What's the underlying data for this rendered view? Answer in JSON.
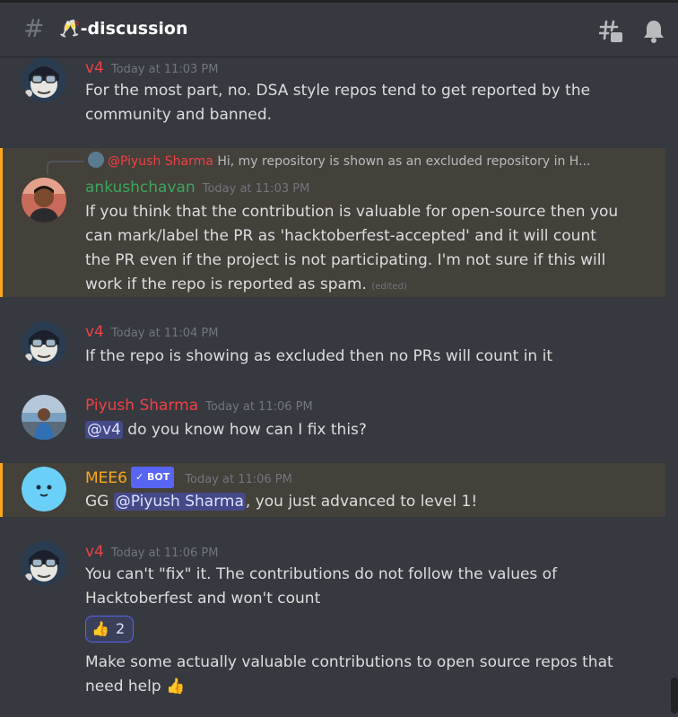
{
  "channel": {
    "icon": "hash-icon",
    "name": "🥂-discussion"
  },
  "header_icons": [
    "threads-icon",
    "bell-icon"
  ],
  "messages": [
    {
      "author": "v4",
      "author_color": "#ed4245",
      "time": "Today at 11:03 PM",
      "lines": [
        "For the most part, no. DSA style repos tend to get reported by the",
        "community and banned."
      ]
    },
    {
      "reply_to_name": "@Piyush Sharma",
      "reply_preview": "Hi, my repository is shown as an excluded repository in H...",
      "author": "ankushchavan",
      "author_color": "#3ba55d",
      "time": "Today at 11:03 PM",
      "lines": [
        "If you think that the contribution is valuable for open-source then you",
        "can mark/label the PR as 'hacktoberfest-accepted' and it will count",
        "the PR even if the project is not participating. I'm not sure if this will",
        "work if the repo is reported as spam."
      ],
      "edited": "(edited)"
    },
    {
      "author": "v4",
      "time": "Today at 11:04 PM",
      "lines": [
        "If the repo is showing as excluded then no PRs will count in it"
      ]
    },
    {
      "author": "Piyush Sharma",
      "author_color": "#ed4245",
      "time": "Today at 11:06 PM",
      "mention": "@v4",
      "text": " do you know how can I fix this?"
    },
    {
      "author": "MEE6",
      "author_color": "#faa81a",
      "badge": "✓ BOT",
      "time": "Today at 11:06 PM",
      "text_before": "GG ",
      "mention": "@Piyush Sharma",
      "text_after": ", you just advanced to level 1!"
    },
    {
      "author": "v4",
      "time": "Today at 11:06 PM",
      "lines": [
        "You can't \"fix\" it. The contributions do not follow the values of",
        "Hacktoberfest and won't count"
      ],
      "reaction": {
        "emoji": "👍",
        "count": "2"
      },
      "followup_lines": [
        "Make some actually valuable contributions to open source repos that",
        "need help 👍"
      ]
    }
  ]
}
